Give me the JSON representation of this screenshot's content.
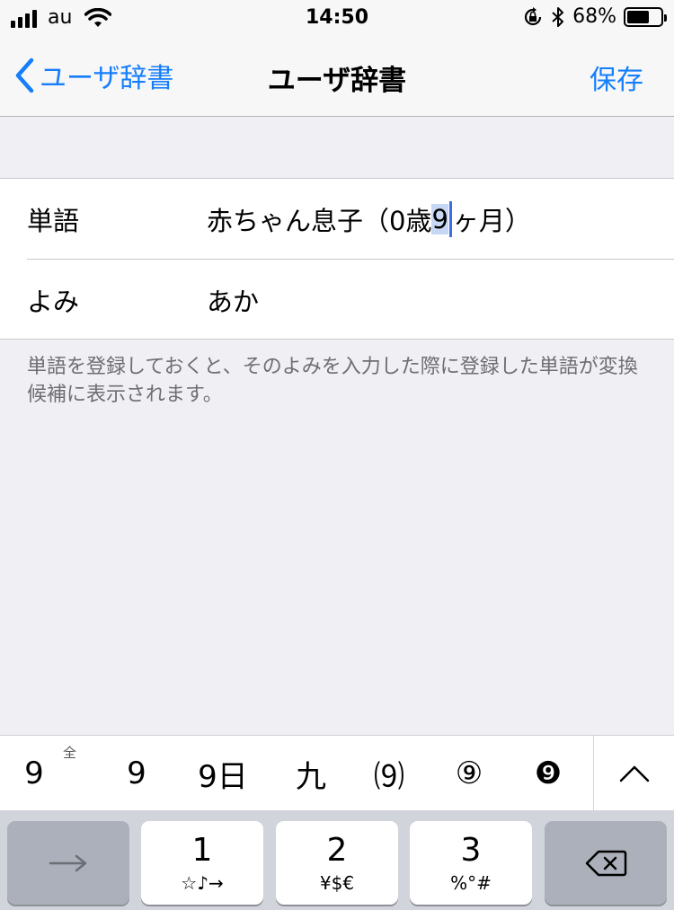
{
  "status_bar": {
    "carrier": "au",
    "time": "14:50",
    "battery_percent": "68%",
    "battery_level": 0.68,
    "icons": [
      "signal-bars-icon",
      "wifi-icon",
      "orientation-lock-icon",
      "bluetooth-icon",
      "battery-icon"
    ]
  },
  "nav": {
    "back_label": "ユーザ辞書",
    "title": "ユーザ辞書",
    "save_label": "保存",
    "accent_color": "#157efb"
  },
  "form": {
    "word": {
      "label": "単語",
      "value_before": "赤ちゃん息子（0歳",
      "value_selected": "9",
      "value_after": "ヶ月）"
    },
    "reading": {
      "label": "よみ",
      "value": "あか"
    }
  },
  "footer_note": "単語を登録しておくと、そのよみを入力した際に登録した単語が変換候補に表示されます。",
  "candidates": {
    "items": [
      "9",
      "9",
      "9日",
      "九",
      "⑼",
      "⑨",
      "❾"
    ],
    "first_superscript": "全"
  },
  "keyboard": {
    "next_key_icon": "arrow-right-icon",
    "keys": [
      {
        "main": "1",
        "sub": "☆♪→"
      },
      {
        "main": "2",
        "sub": "¥$€"
      },
      {
        "main": "3",
        "sub": "%°#"
      }
    ],
    "delete_key_icon": "delete-backspace-icon"
  }
}
